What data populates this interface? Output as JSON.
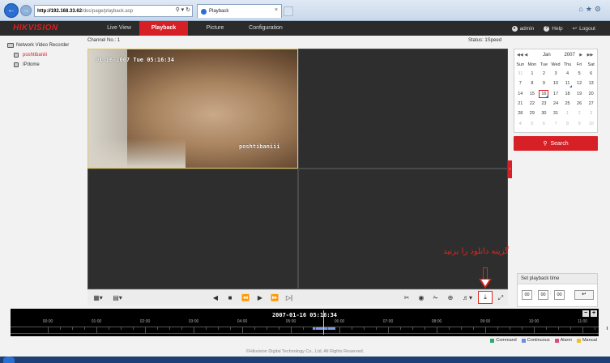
{
  "browser": {
    "url_host": "http://192.168.33.62",
    "url_path": "/doc/page/playback.asp",
    "tab_title": "Playback"
  },
  "app": {
    "logo": "HIKVISION",
    "menu": [
      "Live View",
      "Playback",
      "Picture",
      "Configuration"
    ],
    "active_menu": "Playback",
    "user": "admin",
    "help": "Help",
    "logout": "Logout"
  },
  "tree": {
    "root": "Network Video Recorder",
    "channels": [
      "poshtibaniii",
      "IPdome"
    ],
    "selected": "poshtibaniii"
  },
  "player": {
    "channel_no": "Channel No.: 1",
    "status": "Status: 1Speed",
    "osd_date": "01-16-2007 Tue 05:16:34",
    "osd_name": "poshtibaniii"
  },
  "annotation": "گزینه دانلود را بزنید",
  "calendar": {
    "month": "Jan",
    "year": "2007",
    "weekdays": [
      "Sun",
      "Mon",
      "Tue",
      "Wed",
      "Thu",
      "Fri",
      "Sat"
    ],
    "weeks": [
      [
        "31",
        "1",
        "2",
        "3",
        "4",
        "5",
        "6"
      ],
      [
        "7",
        "8",
        "9",
        "10",
        "11",
        "12",
        "13"
      ],
      [
        "14",
        "15",
        "16",
        "17",
        "18",
        "19",
        "20"
      ],
      [
        "21",
        "22",
        "23",
        "24",
        "25",
        "26",
        "27"
      ],
      [
        "28",
        "29",
        "30",
        "31",
        "1",
        "2",
        "3"
      ],
      [
        "4",
        "5",
        "6",
        "7",
        "8",
        "9",
        "10"
      ]
    ],
    "today": "16",
    "recorded_days": [
      "11",
      "16"
    ],
    "search_label": "Search"
  },
  "playback_time": {
    "title": "Set playback time",
    "hh": "00",
    "mm": "00",
    "ss": "00"
  },
  "timeline": {
    "current": "2007-01-16 05:16:34",
    "labels": [
      "00:00",
      "01:00",
      "02:00",
      "03:00",
      "04:00",
      "05:00",
      "06:00",
      "07:00",
      "08:00",
      "09:00",
      "10:00",
      "11:00"
    ]
  },
  "legend": [
    {
      "label": "Command",
      "color": "#2eaa6e"
    },
    {
      "label": "Continuous",
      "color": "#6b8de0"
    },
    {
      "label": "Alarm",
      "color": "#e0487c"
    },
    {
      "label": "Manual",
      "color": "#f0c020"
    }
  ],
  "footer": "©Hikvision Digital Technology Co., Ltd. All Rights Reserved.",
  "colors": {
    "brand_red": "#d71f26",
    "header_bg": "#2b2b2b",
    "annotation_red": "#e0261f"
  }
}
